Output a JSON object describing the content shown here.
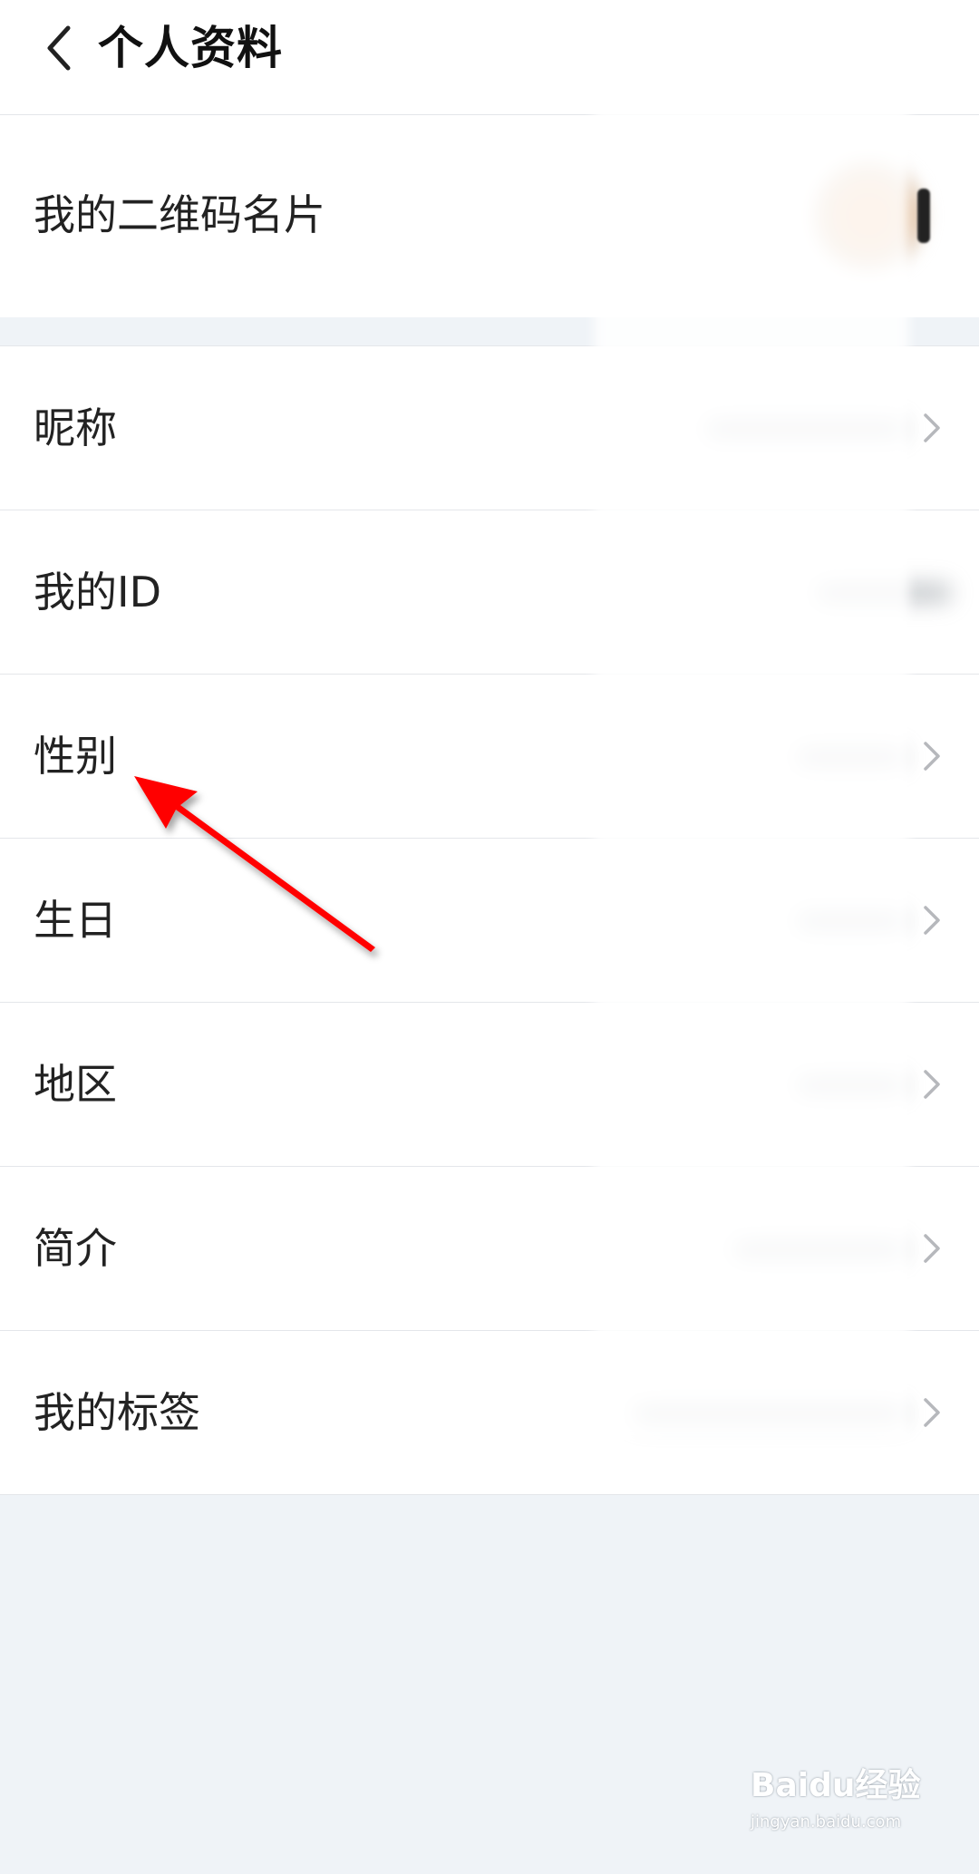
{
  "header": {
    "title": "个人资料",
    "back_icon": "chevron-left-icon"
  },
  "qr_row": {
    "label": "我的二维码名片"
  },
  "list": [
    {
      "key": "nickname",
      "label": "昵称",
      "has_chevron": true
    },
    {
      "key": "id",
      "label": "我的ID",
      "has_chevron": false
    },
    {
      "key": "gender",
      "label": "性别",
      "has_chevron": true
    },
    {
      "key": "birthday",
      "label": "生日",
      "has_chevron": true
    },
    {
      "key": "region",
      "label": "地区",
      "has_chevron": true
    },
    {
      "key": "bio",
      "label": "简介",
      "has_chevron": true
    },
    {
      "key": "tags",
      "label": "我的标签",
      "has_chevron": true
    }
  ],
  "watermark": {
    "brand": "Baidu经验",
    "sub": "jingyan.baidu.com"
  },
  "colors": {
    "background": "#eff3f7",
    "surface": "#ffffff",
    "divider": "#e4e6ea",
    "text": "#222222",
    "chevron": "#b6b8bc",
    "arrow": "#ff0000"
  }
}
